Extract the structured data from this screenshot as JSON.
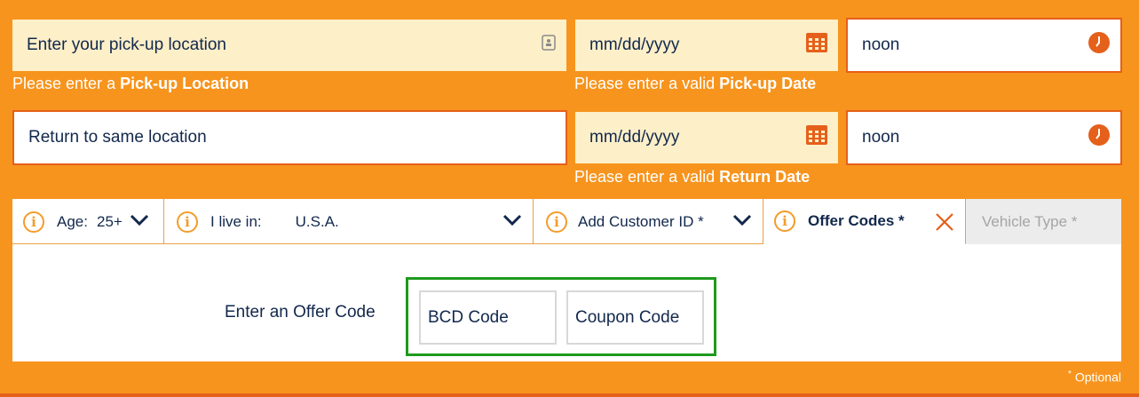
{
  "row1": {
    "location_placeholder": "Enter your pick-up location",
    "date_placeholder": "mm/dd/yyyy",
    "time_value": "noon",
    "location_hint_prefix": "Please enter a ",
    "location_hint_bold": "Pick-up Location",
    "date_hint_prefix": "Please enter a valid ",
    "date_hint_bold": "Pick-up Date"
  },
  "row2": {
    "return_location": "Return to same location",
    "date_placeholder": "mm/dd/yyyy",
    "time_value": "noon",
    "date_hint_prefix": "Please enter a valid ",
    "date_hint_bold": "Return Date"
  },
  "tabs": {
    "info_glyph": "i",
    "age_label": "Age:",
    "age_value": "25+",
    "live_label": "I live in:",
    "live_value": "U.S.A.",
    "customer_id": "Add Customer ID *",
    "offer_codes": "Offer Codes *",
    "vehicle_type": "Vehicle Type *"
  },
  "offer": {
    "label": "Enter an Offer Code",
    "bcd_placeholder": "BCD Code",
    "coupon_placeholder": "Coupon Code"
  },
  "footer": {
    "optional_mark": "*",
    "optional_text": " Optional"
  },
  "colors": {
    "background": "#f7941d",
    "field_border": "#e5601a",
    "field_cream": "#fdefc8",
    "text_navy": "#12284c",
    "highlight_green": "#1e9a1e"
  },
  "icons": {
    "location": "address-card-icon",
    "calendar": "calendar-icon",
    "clock": "clock-icon",
    "chevron": "chevron-down-icon",
    "close": "close-icon",
    "info": "info-icon"
  }
}
